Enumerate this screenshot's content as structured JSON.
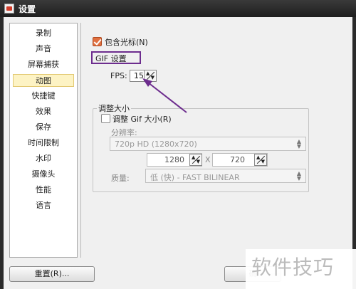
{
  "window": {
    "title": "设置"
  },
  "sidebar": {
    "items": [
      {
        "label": "录制"
      },
      {
        "label": "声音"
      },
      {
        "label": "屏幕捕获"
      },
      {
        "label": "动图"
      },
      {
        "label": "快捷键"
      },
      {
        "label": "效果"
      },
      {
        "label": "保存"
      },
      {
        "label": "时间限制"
      },
      {
        "label": "水印"
      },
      {
        "label": "摄像头"
      },
      {
        "label": "性能"
      },
      {
        "label": "语言"
      }
    ],
    "selected_index": 3
  },
  "gif": {
    "include_cursor_label": "包含光标(N)",
    "include_cursor_checked": true,
    "group_title": "GIF 设置",
    "fps_label": "FPS:",
    "fps_value": "15"
  },
  "resize": {
    "group_title": "调整大小",
    "checkbox_label": "调整 Gif 大小(R)",
    "checkbox_checked": false,
    "resolution_label": "分辨率:",
    "resolution_value": "720p HD (1280x720)",
    "width_value": "1280",
    "times_symbol": "X",
    "height_value": "720",
    "quality_label": "质量:",
    "quality_value": "低 (快) - FAST BILINEAR"
  },
  "buttons": {
    "reset_label": "重置(R)...",
    "ok_label": "确"
  },
  "watermark": {
    "text": "软件技巧"
  },
  "colors": {
    "annotation": "#6d2d8e",
    "checkbox_checked": "#e07040",
    "selected_item_bg": "#fdf3c4"
  }
}
